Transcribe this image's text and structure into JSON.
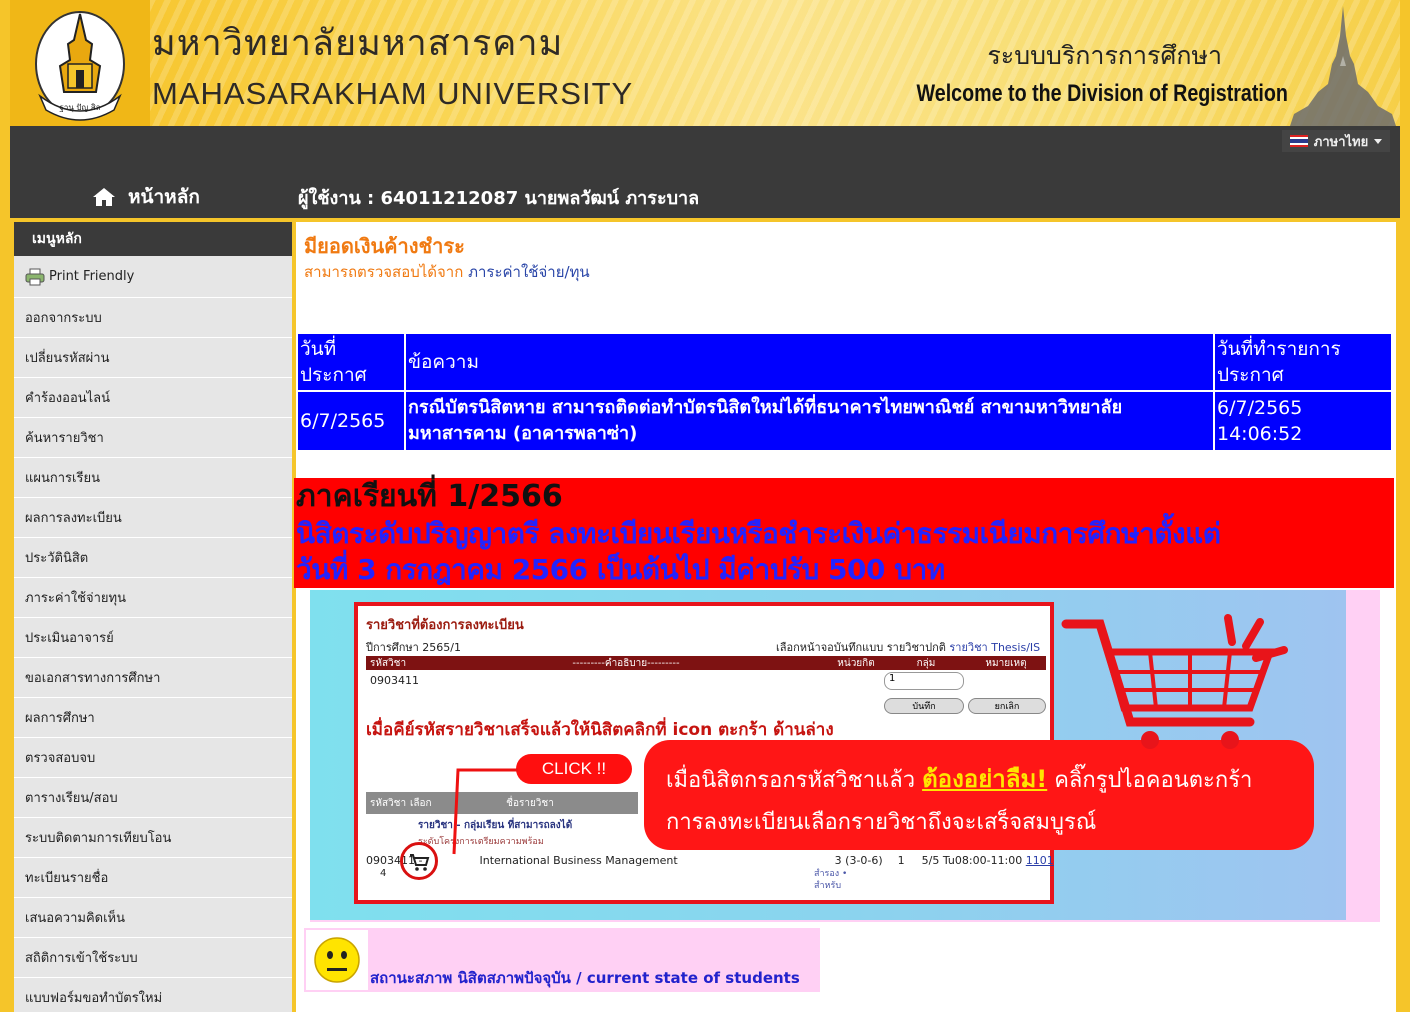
{
  "header": {
    "university_th": "มหาวิทยาลัยมหาสารคาม",
    "university_en": "MAHASARAKHAM UNIVERSITY",
    "service_th": "ระบบบริการการศึกษา",
    "service_en": "Welcome to the Division of Registration",
    "language": "ภาษาไทย"
  },
  "nav": {
    "home": "หน้าหลัก",
    "user": "ผู้ใช้งาน : 64011212087 นายพลวัฒน์ ภาระบาล"
  },
  "sidebar": {
    "title": "เมนูหลัก",
    "items": [
      {
        "label": "Print Friendly"
      },
      {
        "label": "ออกจากระบบ"
      },
      {
        "label": "เปลี่ยนรหัสผ่าน"
      },
      {
        "label": "คำร้องออนไลน์"
      },
      {
        "label": "ค้นหารายวิชา"
      },
      {
        "label": "แผนการเรียน"
      },
      {
        "label": "ผลการลงทะเบียน"
      },
      {
        "label": "ประวัตินิสิต"
      },
      {
        "label": "ภาระค่าใช้จ่ายทุน"
      },
      {
        "label": "ประเมินอาจารย์"
      },
      {
        "label": "ขอเอกสารทางการศึกษา"
      },
      {
        "label": "ผลการศึกษา"
      },
      {
        "label": "ตรวจสอบจบ"
      },
      {
        "label": "ตารางเรียน/สอบ"
      },
      {
        "label": "ระบบติดตามการเทียบโอน"
      },
      {
        "label": "ทะเบียนรายชื่อ"
      },
      {
        "label": "เสนอความคิดเห็น"
      },
      {
        "label": "สถิติการเข้าใช้ระบบ"
      },
      {
        "label": "แบบฟอร์มขอทำบัตรใหม่"
      }
    ]
  },
  "main": {
    "warning_title": "มียอดเงินค้างชำระ",
    "warning_sub": "สามารถตรวจสอบได้จาก",
    "warning_link": "ภาระค่าใช้จ่าย/ทุน",
    "announcements": {
      "col_date_line1": "วันที่",
      "col_date_line2": "ประกาศ",
      "col_message": "ข้อความ",
      "col_posted_line1": "วันที่ทำรายการ",
      "col_posted_line2": "ประกาศ",
      "rows": [
        {
          "date": "6/7/2565",
          "message": "กรณีบัตรนิสิตหาย สามารถติดต่อทำบัตรนิสิตใหม่ได้ที่ธนาคารไทยพาณิชย์ สาขามหาวิทยาลัย มหาสารคาม (อาคารพลาซ่า)",
          "posted_date": "6/7/2565",
          "posted_time": "14:06:52"
        }
      ]
    },
    "notice": {
      "line1": "ภาคเรียนที่ 1/2566",
      "line2": "นิสิตระดับปริญญาตรี ลงทะเบียนเรียนหรือชำระเงินค่าธรรมเนียมการศึกษาตั้งแต่",
      "line3": "วันที่ 3 กรกฎาคม 2566 เป็นต้นไป มีค่าปรับ 500 บาท"
    },
    "tutorial": {
      "title": "รายวิชาที่ต้องการลงทะเบียน",
      "year": "ปีการศึกษา 2565/1",
      "options_prefix": "เลือกหน้าจอบันทึกแบบ   รายวิชาปกติ",
      "options_link": "รายวิชา Thesis/IS",
      "col_code": "รหัสวิชา",
      "col_desc": "---------คำอธิบาย---------",
      "col_credit": "หน่วยกิต",
      "col_group": "กลุ่ม",
      "col_note": "หมายเหตุ",
      "course_code": "0903411",
      "group_value": "1",
      "save": "บันทึก",
      "cancel": "ยกเลิก",
      "instruction": "เมื่อคีย์รหัสรายวิชาเสร็จแล้วให้นิสิตคลิกที่ icon ตะกร้า ด้านล่าง",
      "click": "CLICK !!",
      "list_code": "รหัสวิชา",
      "list_select": "เลือก",
      "list_name": "ชื่อรายวิชา",
      "list_group": "รายวิชา - กลุ่มเรียน ที่สามารถลงได้",
      "list_level": "ระดับโครงการเตรียมความพร้อม",
      "list_code_value": "0903411",
      "list_dash": "-",
      "list_section": "4",
      "list_course": "International Business Management",
      "list_credit": "3 (3-0-6)",
      "list_num": "1",
      "list_seats": "5/5",
      "list_time": "Tu08:00-11:00",
      "list_room": "1101",
      "list_reserved": "สำรอง •",
      "list_for": "สำหรับ",
      "bubble_line1_a": "เมื่อนิสิตกรอกรหัสวิชาแล้ว",
      "bubble_line1_em": "ต้องอย่าลืม!",
      "bubble_line1_b": "คลิ๊กรูปไอคอนตะกร้า",
      "bubble_line2": "การลงทะเบียนเลือกรายวิชาถึงจะเสร็จสมบูรณ์"
    },
    "status": "สถานะสภาพ นิสิตสภาพปัจจุบัน / current state of students"
  }
}
